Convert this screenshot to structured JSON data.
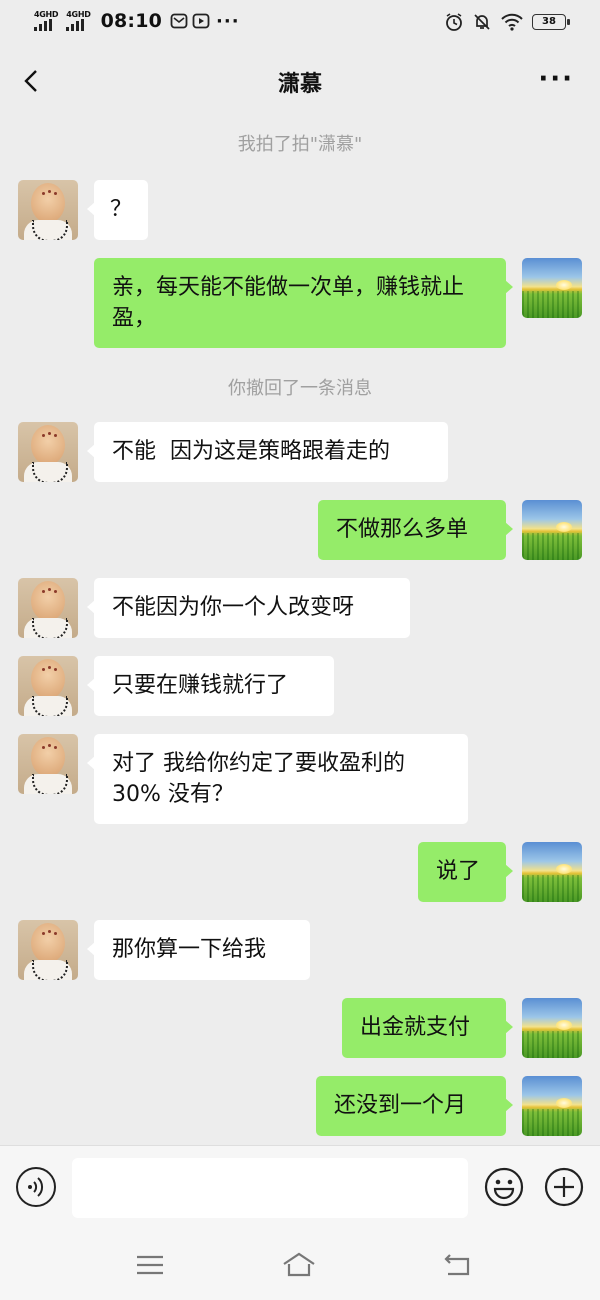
{
  "status_bar": {
    "network1": "4GHD",
    "network2": "4GHD",
    "time": "08:10",
    "more": "···",
    "battery": "38"
  },
  "header": {
    "title": "潇慕",
    "more": "···"
  },
  "chat": {
    "system_messages": [
      "我拍了拍\"潇慕\"",
      "你撤回了一条消息"
    ],
    "messages": [
      {
        "side": "left",
        "text": "？"
      },
      {
        "side": "right",
        "text": "亲，每天能不能做一次单，赚钱就止盈，"
      },
      {
        "side": "left",
        "text": "不能  因为这是策略跟着走的"
      },
      {
        "side": "right",
        "text": "不做那么多单"
      },
      {
        "side": "left",
        "text": "不能因为你一个人改变呀"
      },
      {
        "side": "left",
        "text": "只要在赚钱就行了"
      },
      {
        "side": "left",
        "text": "对了 我给你约定了要收盈利的30% 没有？"
      },
      {
        "side": "right",
        "text": "说了"
      },
      {
        "side": "left",
        "text": "那你算一下给我"
      },
      {
        "side": "right",
        "text": "出金就支付"
      },
      {
        "side": "right",
        "text": "还没到一个月"
      }
    ]
  },
  "input_bar": {
    "placeholder": "",
    "icons": [
      "voice-icon",
      "emoji-icon",
      "plus-icon"
    ]
  },
  "system_nav": {
    "icons": [
      "menu-icon",
      "home-icon",
      "back-icon"
    ]
  }
}
